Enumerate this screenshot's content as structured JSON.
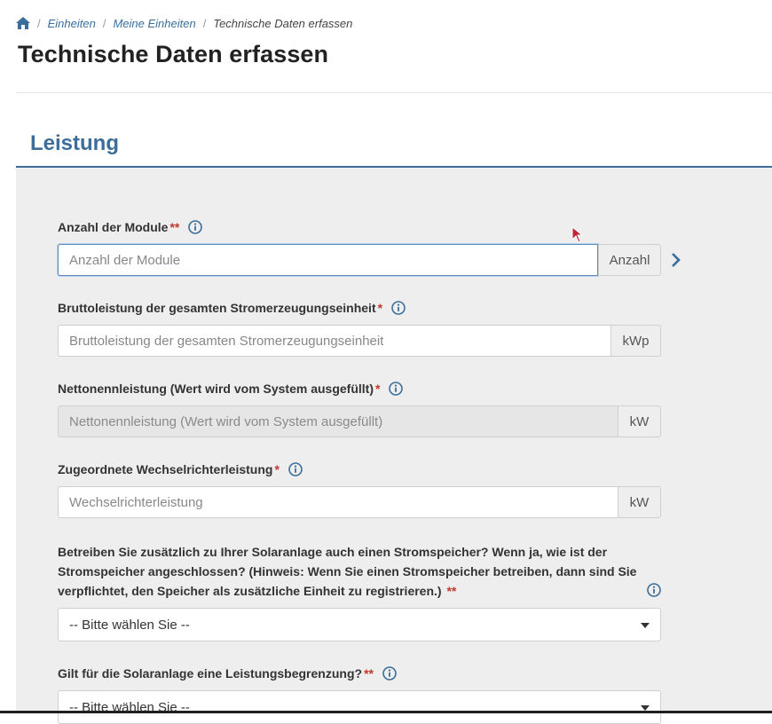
{
  "breadcrumb": {
    "items": [
      "Einheiten",
      "Meine Einheiten"
    ],
    "current": "Technische Daten erfassen",
    "separator": "/"
  },
  "page": {
    "title": "Technische Daten erfassen"
  },
  "section": {
    "title": "Leistung"
  },
  "fields": {
    "module": {
      "label": "Anzahl der Module",
      "required_mark": "**",
      "placeholder": "Anzahl der Module",
      "addon": "Anzahl"
    },
    "brutto": {
      "label": "Bruttoleistung der gesamten Stromerzeugungseinheit",
      "required_mark": "*",
      "placeholder": "Bruttoleistung der gesamten Stromerzeugungseinheit",
      "addon": "kWp"
    },
    "netto": {
      "label": "Nettonennleistung (Wert wird vom System ausgefüllt)",
      "required_mark": "*",
      "placeholder": "Nettonennleistung (Wert wird vom System ausgefüllt)",
      "addon": "kW"
    },
    "wechselrichter": {
      "label": "Zugeordnete Wechselrichterleistung",
      "required_mark": "*",
      "placeholder": "Wechselrichterleistung",
      "addon": "kW"
    },
    "stromspeicher": {
      "label": "Betreiben Sie zusätzlich zu Ihrer Solaranlage auch einen Stromspeicher? Wenn ja, wie ist der Stromspeicher angeschlossen? (Hinweis: Wenn Sie einen Stromspeicher betreiben, dann sind Sie verpflichtet, den Speicher als zusätzliche Einheit zu registrieren.)",
      "required_mark": "**",
      "selected": "-- Bitte wählen Sie --"
    },
    "leistungsbegrenzung": {
      "label": "Gilt für die Solaranlage eine Leistungsbegrenzung?",
      "required_mark": "**",
      "selected": "-- Bitte wählen Sie --"
    }
  },
  "colors": {
    "accent": "#3c6e99",
    "link": "#3b6f9b",
    "required": "#c0392b",
    "panel_bg": "#eeeeee"
  },
  "icons": [
    "home-icon",
    "info-icon",
    "chevron-right-icon",
    "caret-down-icon",
    "mouse-cursor-icon"
  ]
}
